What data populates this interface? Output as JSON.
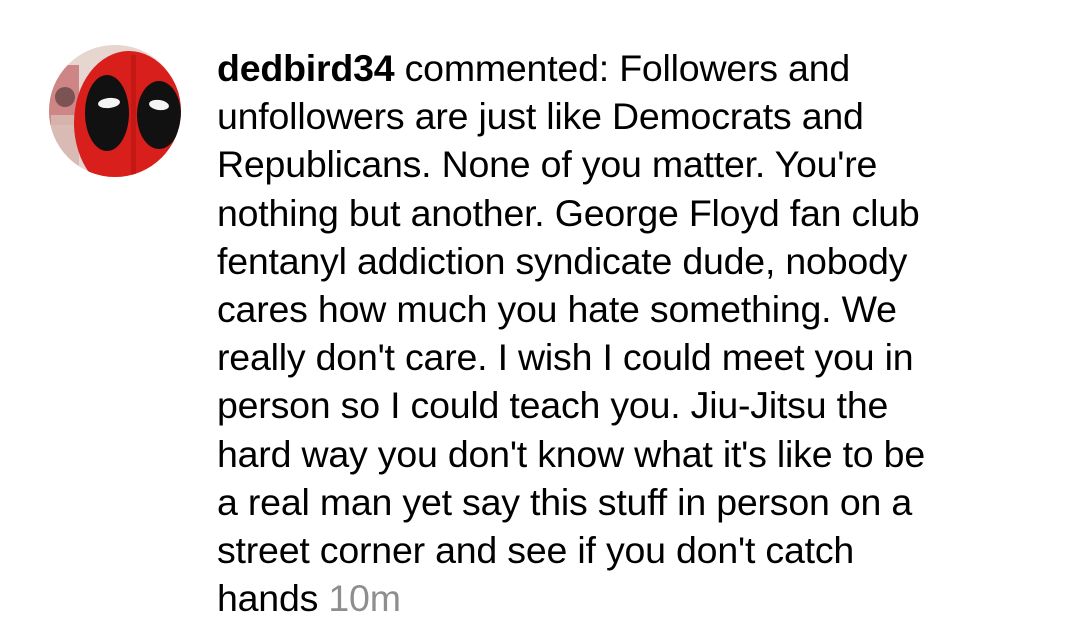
{
  "comment": {
    "username": "dedbird34",
    "action": " commented: ",
    "lines": [
      "Followers and",
      "unfollowers are just like Democrats and",
      "Republicans. None of you matter.  You're",
      "nothing but another. George Floyd fan club",
      "fentanyl addiction syndicate dude, nobody",
      "cares how much you hate something. We",
      "really don't care. I wish I could meet you in",
      "person so I could teach you. Jiu-Jitsu the",
      "hard way you don't know what it's like to be",
      "a real man yet say this stuff in person on a",
      "street corner and see if you don't catch",
      "hands "
    ],
    "timestamp": "10m"
  },
  "avatar": {
    "icon": "deadpool-mask-avatar",
    "colors": {
      "mask_red": "#d81f1b",
      "eye_patch": "#111111",
      "eye_white": "#f4f4f4",
      "background": "#e7d6cf"
    }
  },
  "colors": {
    "text": "#000000",
    "timestamp": "#8e8e8e",
    "background": "#ffffff"
  }
}
